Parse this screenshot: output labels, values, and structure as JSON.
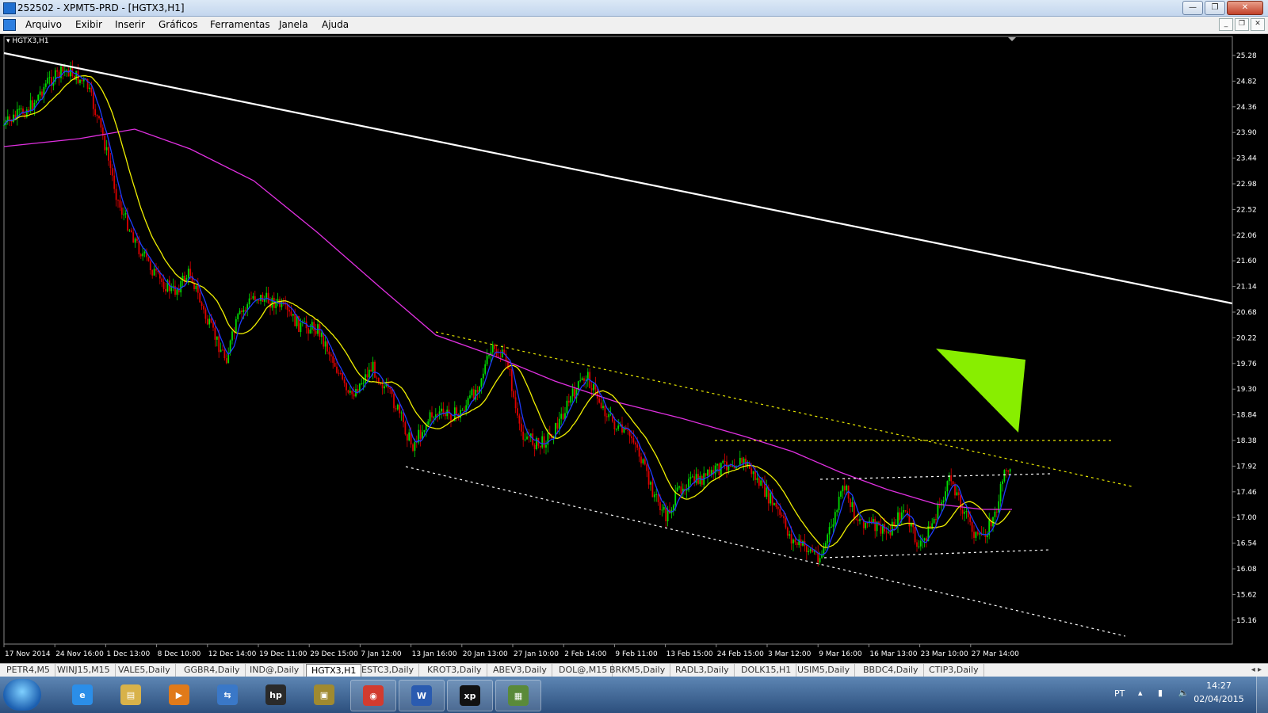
{
  "window": {
    "title": "252502 - XPMT5-PRD - [HGTX3,H1]",
    "buttons": {
      "minimize": "—",
      "maximize": "❐",
      "close": "✕"
    }
  },
  "menu": [
    "Arquivo",
    "Exibir",
    "Inserir",
    "Gráficos",
    "Ferramentas",
    "Janela",
    "Ajuda"
  ],
  "chart": {
    "symbol_label": "HGTX3,H1",
    "price_axis": [
      "25.28",
      "24.82",
      "24.36",
      "23.90",
      "23.44",
      "22.98",
      "22.52",
      "22.06",
      "21.60",
      "21.14",
      "20.68",
      "20.22",
      "19.76",
      "19.30",
      "18.84",
      "18.38",
      "17.92",
      "17.46",
      "17.00",
      "16.54",
      "16.08",
      "15.62",
      "15.16"
    ],
    "time_axis": [
      "17 Nov 2014",
      "24 Nov 16:00",
      "1 Dec 13:00",
      "8 Dec 10:00",
      "12 Dec 14:00",
      "19 Dec 11:00",
      "29 Dec 15:00",
      "7 Jan 12:00",
      "13 Jan 16:00",
      "20 Jan 13:00",
      "27 Jan 10:00",
      "2 Feb 14:00",
      "9 Feb 11:00",
      "13 Feb 15:00",
      "24 Feb 15:00",
      "3 Mar 12:00",
      "9 Mar 16:00",
      "16 Mar 13:00",
      "23 Mar 10:00",
      "27 Mar 14:00"
    ],
    "colors": {
      "background": "#000000",
      "trendline_main": "#ffffff",
      "channel_lines": "#ffffff",
      "resistance_lines": "#e8e800",
      "ma_fast": "#1e3cff",
      "ma_mid": "#f0f000",
      "ma_slow": "#e030e0",
      "candle_up": "#00dd00",
      "candle_down": "#dd0000",
      "arrow": "#88ee00"
    }
  },
  "tabs": {
    "items": [
      "PETR4,M5",
      "WINJ15,M15",
      "VALE5,Daily",
      "GGBR4,Daily",
      "IND@,Daily",
      "HGTX3,H1",
      "ESTC3,Daily",
      "KROT3,Daily",
      "ABEV3,Daily",
      "DOL@,M15",
      "BRKM5,Daily",
      "RADL3,Daily",
      "DOLK15,H1",
      "USIM5,Daily",
      "BBDC4,Daily",
      "CTIP3,Daily"
    ],
    "active": "HGTX3,H1",
    "scroll": "◂ ▸"
  },
  "taskbar": {
    "items": [
      {
        "name": "internet-explorer",
        "glyph": "e",
        "color": "#2b8ee8"
      },
      {
        "name": "file-explorer",
        "glyph": "▤",
        "color": "#d8b24a"
      },
      {
        "name": "media-player",
        "glyph": "▶",
        "color": "#e07a1a"
      },
      {
        "name": "network-app",
        "glyph": "⇆",
        "color": "#3a78c8"
      },
      {
        "name": "hp-app",
        "glyph": "hp",
        "color": "#2a2a2a"
      },
      {
        "name": "archive-app",
        "glyph": "▣",
        "color": "#a08a30"
      },
      {
        "name": "chrome",
        "glyph": "◉",
        "color": "#d23b2f"
      },
      {
        "name": "word",
        "glyph": "W",
        "color": "#2a5bb0"
      },
      {
        "name": "xp-app",
        "glyph": "xp",
        "color": "#111111"
      },
      {
        "name": "metatrader",
        "glyph": "▦",
        "color": "#5a8a3a"
      }
    ],
    "tray": {
      "language": "PT",
      "time": "14:27",
      "date": "02/04/2015"
    }
  }
}
